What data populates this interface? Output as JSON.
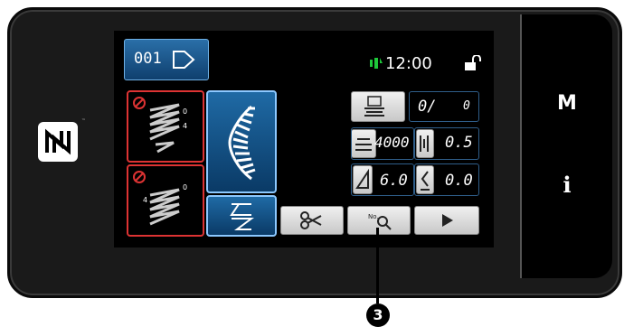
{
  "header": {
    "pattern_no": "001",
    "time": "12:00"
  },
  "counter": {
    "value": "0/",
    "limit": "0"
  },
  "speed": {
    "value": "4000"
  },
  "pitch": {
    "value": "0.5"
  },
  "width": {
    "value": "6.0"
  },
  "offset": {
    "value": "0.0"
  },
  "side": {
    "mode_label": "M",
    "info_label": "i"
  },
  "callout": {
    "number": "3"
  }
}
